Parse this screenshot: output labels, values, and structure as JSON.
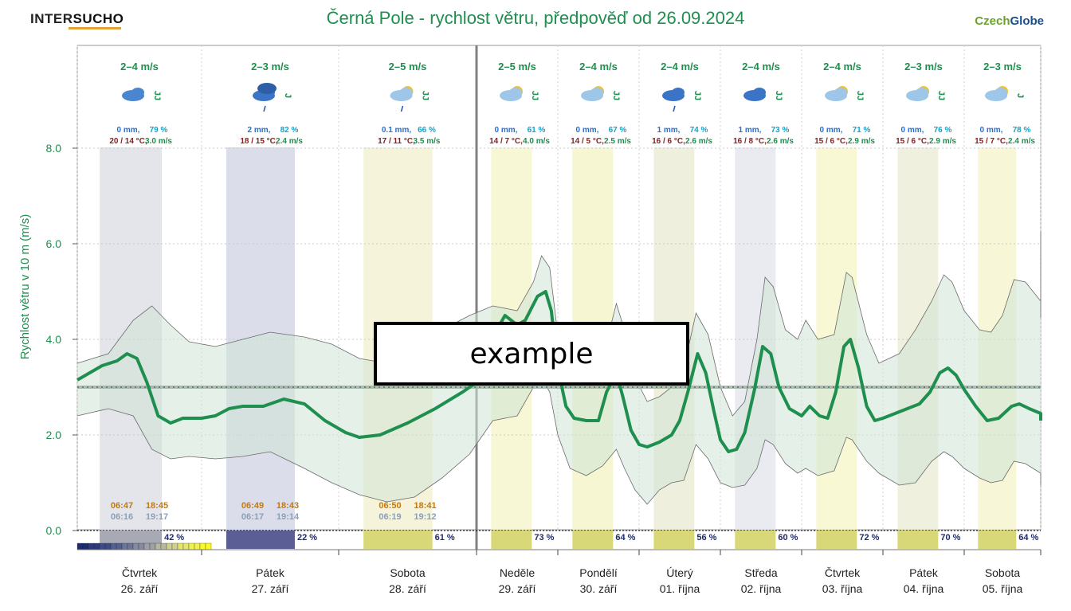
{
  "title": "Černá Pole - rychlost větru, předpověď od 26.09.2024",
  "logo_left": {
    "part1": "INTER",
    "part2": "SUCHO"
  },
  "logo_right": {
    "part1": "Czech",
    "part2": "Globe"
  },
  "overlay_label": "example",
  "colors": {
    "accent": "#1e8f4e",
    "band": "#cfe3d5",
    "precip": "#2a6fd1",
    "humidity": "#17a2c8",
    "temp": "#8a1c1c",
    "sunrise": "#c8780b",
    "dim": "#8aa0b8",
    "navy": "#1c2a6e"
  },
  "chart_data": {
    "type": "line",
    "ylabel": "Rychlost větru v 10 m (m/s)",
    "ylim": [
      0,
      10
    ],
    "yticks": [
      "0.0",
      "2.0",
      "4.0",
      "6.0",
      "8.0"
    ],
    "reference_line": 3.0,
    "x_domain_days": [
      0,
      12
    ],
    "series": [
      {
        "values": [
          [
            0,
            3.15
          ],
          [
            0.1,
            3.3
          ],
          [
            0.2,
            3.45
          ],
          [
            0.32,
            3.55
          ],
          [
            0.4,
            3.7
          ],
          [
            0.48,
            3.6
          ],
          [
            0.56,
            3.1
          ],
          [
            0.65,
            2.4
          ],
          [
            0.75,
            2.25
          ],
          [
            0.85,
            2.35
          ],
          [
            1.0,
            2.35
          ],
          [
            1.1,
            2.4
          ],
          [
            1.2,
            2.55
          ],
          [
            1.3,
            2.6
          ],
          [
            1.45,
            2.6
          ],
          [
            1.6,
            2.75
          ],
          [
            1.75,
            2.65
          ],
          [
            1.9,
            2.3
          ],
          [
            2.05,
            2.05
          ],
          [
            2.15,
            1.95
          ],
          [
            2.3,
            2.0
          ],
          [
            2.5,
            2.25
          ],
          [
            2.7,
            2.55
          ],
          [
            2.9,
            2.9
          ],
          [
            3.0,
            3.1
          ],
          [
            3.1,
            3.5
          ],
          [
            3.25,
            4.2
          ],
          [
            3.35,
            4.5
          ],
          [
            3.5,
            4.3
          ],
          [
            3.6,
            4.4
          ],
          [
            3.75,
            4.9
          ],
          [
            3.85,
            5.0
          ],
          [
            3.92,
            4.6
          ],
          [
            4.0,
            3.4
          ],
          [
            4.1,
            2.6
          ],
          [
            4.2,
            2.35
          ],
          [
            4.35,
            2.3
          ],
          [
            4.5,
            2.3
          ],
          [
            4.6,
            2.9
          ],
          [
            4.72,
            3.3
          ],
          [
            4.8,
            2.8
          ],
          [
            4.9,
            2.1
          ],
          [
            5.0,
            1.8
          ],
          [
            5.1,
            1.75
          ],
          [
            5.25,
            1.85
          ],
          [
            5.4,
            2.0
          ],
          [
            5.5,
            2.3
          ],
          [
            5.6,
            2.9
          ],
          [
            5.72,
            3.7
          ],
          [
            5.82,
            3.3
          ],
          [
            5.92,
            2.5
          ],
          [
            6.0,
            1.9
          ],
          [
            6.1,
            1.65
          ],
          [
            6.2,
            1.7
          ],
          [
            6.3,
            2.05
          ],
          [
            6.42,
            2.95
          ],
          [
            6.52,
            3.85
          ],
          [
            6.62,
            3.7
          ],
          [
            6.72,
            3.0
          ],
          [
            6.85,
            2.55
          ],
          [
            7.0,
            2.4
          ],
          [
            7.1,
            2.6
          ],
          [
            7.22,
            2.4
          ],
          [
            7.32,
            2.35
          ],
          [
            7.42,
            2.9
          ],
          [
            7.52,
            3.85
          ],
          [
            7.6,
            4.0
          ],
          [
            7.7,
            3.4
          ],
          [
            7.8,
            2.6
          ],
          [
            7.9,
            2.3
          ],
          [
            8.0,
            2.35
          ],
          [
            8.15,
            2.45
          ],
          [
            8.3,
            2.55
          ],
          [
            8.45,
            2.65
          ],
          [
            8.58,
            2.9
          ],
          [
            8.7,
            3.3
          ],
          [
            8.8,
            3.4
          ],
          [
            8.9,
            3.25
          ],
          [
            9.0,
            2.95
          ],
          [
            9.15,
            2.6
          ],
          [
            9.3,
            2.3
          ],
          [
            9.45,
            2.35
          ],
          [
            9.62,
            2.6
          ],
          [
            9.72,
            2.65
          ],
          [
            9.85,
            2.55
          ],
          [
            10.0,
            2.45
          ],
          [
            10.15,
            2.4
          ],
          [
            10.3,
            2.35
          ],
          [
            10.45,
            2.35
          ],
          [
            10.6,
            2.35
          ],
          [
            10.8,
            2.35
          ],
          [
            11.0,
            2.3
          ],
          [
            11.2,
            2.3
          ],
          [
            11.5,
            2.3
          ],
          [
            11.8,
            2.3
          ],
          [
            12.0,
            2.3
          ]
        ]
      }
    ],
    "band_upper": [
      [
        0,
        3.5
      ],
      [
        0.25,
        3.7
      ],
      [
        0.45,
        4.4
      ],
      [
        0.6,
        4.7
      ],
      [
        0.75,
        4.3
      ],
      [
        0.9,
        3.95
      ],
      [
        1.1,
        3.85
      ],
      [
        1.3,
        4.0
      ],
      [
        1.5,
        4.15
      ],
      [
        1.75,
        4.05
      ],
      [
        1.95,
        3.9
      ],
      [
        2.15,
        3.6
      ],
      [
        2.35,
        3.5
      ],
      [
        2.55,
        3.75
      ],
      [
        2.75,
        4.2
      ],
      [
        2.95,
        4.5
      ],
      [
        3.2,
        4.7
      ],
      [
        3.5,
        4.6
      ],
      [
        3.7,
        5.2
      ],
      [
        3.8,
        5.75
      ],
      [
        3.9,
        5.5
      ],
      [
        4.0,
        4.1
      ],
      [
        4.15,
        3.6
      ],
      [
        4.35,
        3.5
      ],
      [
        4.55,
        3.6
      ],
      [
        4.72,
        4.75
      ],
      [
        4.82,
        4.2
      ],
      [
        4.95,
        3.2
      ],
      [
        5.1,
        2.7
      ],
      [
        5.25,
        2.8
      ],
      [
        5.4,
        3.0
      ],
      [
        5.55,
        3.4
      ],
      [
        5.7,
        4.55
      ],
      [
        5.85,
        4.1
      ],
      [
        6.0,
        3.0
      ],
      [
        6.15,
        2.4
      ],
      [
        6.3,
        2.7
      ],
      [
        6.45,
        4.0
      ],
      [
        6.55,
        5.3
      ],
      [
        6.65,
        5.1
      ],
      [
        6.8,
        4.2
      ],
      [
        6.95,
        4.0
      ],
      [
        7.05,
        4.4
      ],
      [
        7.2,
        4.0
      ],
      [
        7.4,
        4.1
      ],
      [
        7.55,
        5.4
      ],
      [
        7.62,
        5.3
      ],
      [
        7.8,
        4.1
      ],
      [
        7.95,
        3.5
      ],
      [
        8.2,
        3.7
      ],
      [
        8.4,
        4.2
      ],
      [
        8.6,
        4.8
      ],
      [
        8.75,
        5.35
      ],
      [
        8.85,
        5.2
      ],
      [
        9.0,
        4.6
      ],
      [
        9.2,
        4.2
      ],
      [
        9.35,
        4.15
      ],
      [
        9.5,
        4.5
      ],
      [
        9.65,
        5.25
      ],
      [
        9.8,
        5.2
      ],
      [
        10.0,
        4.8
      ],
      [
        10.15,
        4.45
      ],
      [
        10.3,
        4.5
      ],
      [
        10.5,
        4.7
      ],
      [
        10.7,
        5.0
      ],
      [
        10.9,
        5.4
      ],
      [
        11.1,
        5.6
      ],
      [
        11.3,
        5.9
      ],
      [
        11.5,
        6.0
      ],
      [
        11.7,
        6.1
      ],
      [
        11.85,
        6.2
      ],
      [
        12.0,
        6.25
      ]
    ],
    "band_lower": [
      [
        0,
        2.4
      ],
      [
        0.25,
        2.55
      ],
      [
        0.45,
        2.4
      ],
      [
        0.6,
        1.7
      ],
      [
        0.75,
        1.5
      ],
      [
        0.9,
        1.55
      ],
      [
        1.1,
        1.5
      ],
      [
        1.3,
        1.55
      ],
      [
        1.5,
        1.65
      ],
      [
        1.75,
        1.3
      ],
      [
        1.95,
        1.0
      ],
      [
        2.15,
        0.75
      ],
      [
        2.35,
        0.6
      ],
      [
        2.55,
        0.7
      ],
      [
        2.75,
        1.1
      ],
      [
        2.95,
        1.6
      ],
      [
        3.2,
        2.3
      ],
      [
        3.5,
        2.4
      ],
      [
        3.7,
        3.0
      ],
      [
        3.8,
        3.2
      ],
      [
        3.9,
        2.9
      ],
      [
        4.0,
        2.0
      ],
      [
        4.15,
        1.3
      ],
      [
        4.35,
        1.15
      ],
      [
        4.55,
        1.35
      ],
      [
        4.72,
        1.7
      ],
      [
        4.82,
        1.3
      ],
      [
        4.95,
        0.85
      ],
      [
        5.1,
        0.55
      ],
      [
        5.25,
        0.85
      ],
      [
        5.4,
        1.0
      ],
      [
        5.55,
        1.05
      ],
      [
        5.7,
        1.8
      ],
      [
        5.85,
        1.5
      ],
      [
        6.0,
        1.0
      ],
      [
        6.15,
        0.9
      ],
      [
        6.3,
        0.95
      ],
      [
        6.45,
        1.3
      ],
      [
        6.55,
        1.9
      ],
      [
        6.65,
        1.8
      ],
      [
        6.8,
        1.4
      ],
      [
        6.95,
        1.2
      ],
      [
        7.05,
        1.3
      ],
      [
        7.2,
        1.15
      ],
      [
        7.4,
        1.25
      ],
      [
        7.55,
        1.95
      ],
      [
        7.62,
        1.9
      ],
      [
        7.8,
        1.45
      ],
      [
        7.95,
        1.2
      ],
      [
        8.2,
        0.95
      ],
      [
        8.4,
        1.0
      ],
      [
        8.6,
        1.45
      ],
      [
        8.75,
        1.65
      ],
      [
        8.85,
        1.55
      ],
      [
        9.0,
        1.3
      ],
      [
        9.2,
        1.1
      ],
      [
        9.35,
        1.0
      ],
      [
        9.5,
        1.05
      ],
      [
        9.65,
        1.45
      ],
      [
        9.8,
        1.4
      ],
      [
        10.0,
        1.2
      ],
      [
        10.15,
        1.05
      ],
      [
        10.3,
        0.95
      ],
      [
        10.5,
        0.95
      ],
      [
        10.7,
        1.05
      ],
      [
        10.9,
        1.1
      ],
      [
        11.1,
        1.05
      ],
      [
        11.3,
        0.95
      ],
      [
        11.5,
        0.95
      ],
      [
        11.7,
        1.0
      ],
      [
        11.85,
        1.0
      ],
      [
        12.0,
        0.95
      ]
    ]
  },
  "days": [
    {
      "name": "Čtvrtek",
      "date": "26. září",
      "wind": "2–4 m/s",
      "rain": "0 mm,",
      "hum": "79 %",
      "temp": "20 / 14 °C,",
      "avg": "3.0 m/s",
      "dir": "JJ",
      "cloud": "42 %",
      "sunrise": "06:47",
      "sunset": "18:45",
      "civ1": "06:16",
      "civ2": "19:17",
      "ex": true
    },
    {
      "name": "Pátek",
      "date": "27. září",
      "wind": "2–3 m/s",
      "rain": "2 mm,",
      "hum": "82 %",
      "temp": "18 / 15 °C,",
      "avg": "2.4 m/s",
      "dir": "J",
      "cloud": "22 %",
      "sunrise": "06:49",
      "sunset": "18:43",
      "civ1": "06:17",
      "civ2": "19:14",
      "ex": true
    },
    {
      "name": "Sobota",
      "date": "28. září",
      "wind": "2–5 m/s",
      "rain": "0.1 mm,",
      "hum": "66 %",
      "temp": "17 / 11 °C,",
      "avg": "3.5 m/s",
      "dir": "JJ",
      "cloud": "61 %",
      "sunrise": "06:50",
      "sunset": "18:41",
      "civ1": "06:19",
      "civ2": "19:12",
      "ex": true
    },
    {
      "name": "Neděle",
      "date": "29. září",
      "wind": "2–5 m/s",
      "rain": "0 mm,",
      "hum": "61 %",
      "temp": "14 / 7 °C,",
      "avg": "4.0 m/s",
      "dir": "JJ",
      "cloud": "73 %"
    },
    {
      "name": "Pondělí",
      "date": "30. září",
      "wind": "2–4 m/s",
      "rain": "0 mm,",
      "hum": "67 %",
      "temp": "14 / 5 °C,",
      "avg": "2.5 m/s",
      "dir": "JJ",
      "cloud": "64 %"
    },
    {
      "name": "Úterý",
      "date": "01. října",
      "wind": "2–4 m/s",
      "rain": "1 mm,",
      "hum": "74 %",
      "temp": "16 / 6 °C,",
      "avg": "2.6 m/s",
      "dir": "JJ",
      "cloud": "56 %"
    },
    {
      "name": "Středa",
      "date": "02. října",
      "wind": "2–4 m/s",
      "rain": "1 mm,",
      "hum": "73 %",
      "temp": "16 / 8 °C,",
      "avg": "2.6 m/s",
      "dir": "JJ",
      "cloud": "60 %"
    },
    {
      "name": "Čtvrtek",
      "date": "03. října",
      "wind": "2–4 m/s",
      "rain": "0 mm,",
      "hum": "71 %",
      "temp": "15 / 6 °C,",
      "avg": "2.9 m/s",
      "dir": "JJ",
      "cloud": "72 %"
    },
    {
      "name": "Pátek",
      "date": "04. října",
      "wind": "2–3 m/s",
      "rain": "0 mm,",
      "hum": "76 %",
      "temp": "15 / 6 °C,",
      "avg": "2.9 m/s",
      "dir": "JJ",
      "cloud": "70 %"
    },
    {
      "name": "Sobota",
      "date": "05. října",
      "wind": "2–3 m/s",
      "rain": "0 mm,",
      "hum": "78 %",
      "temp": "15 / 7 °C,",
      "avg": "2.4 m/s",
      "dir": "J",
      "cloud": "64 %"
    }
  ]
}
